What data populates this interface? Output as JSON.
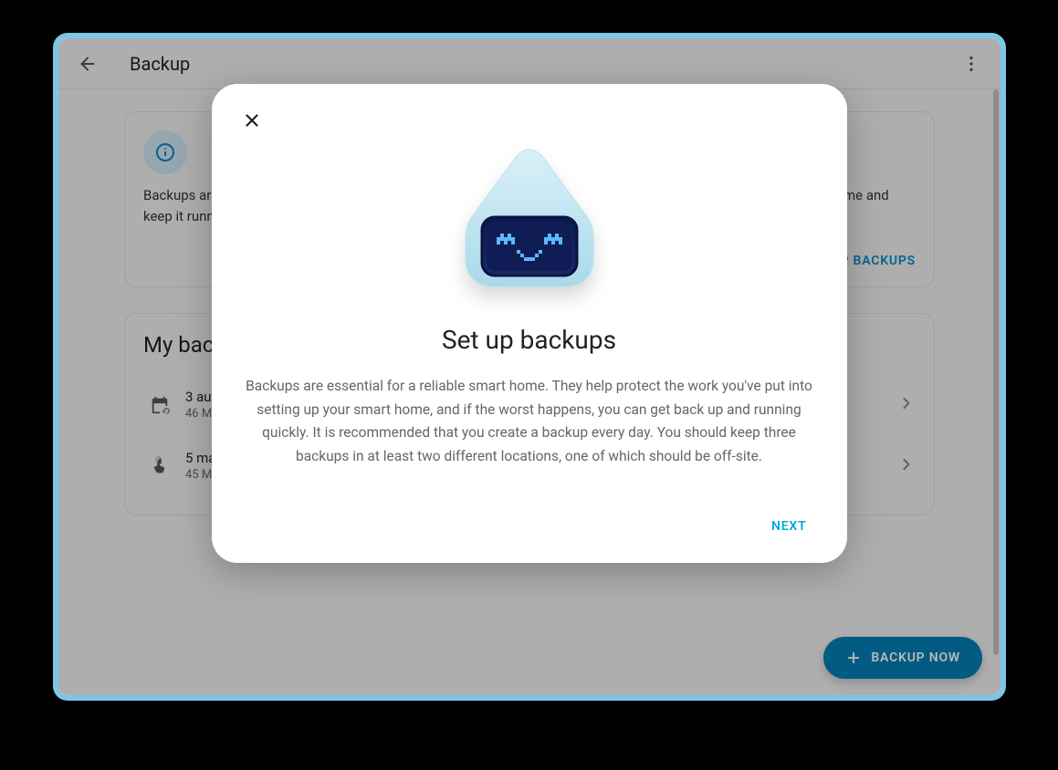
{
  "header": {
    "title": "Backup"
  },
  "info_card": {
    "text": "Backups are essential for a reliable smart home. They help protect the work you've put into setting up your smart home and keep it running.",
    "action_label": "SET UP BACKUPS"
  },
  "my_backups": {
    "title": "My backups",
    "rows": [
      {
        "primary": "3 automatic backups",
        "secondary": "46 MB in total"
      },
      {
        "primary": "5 manual backups",
        "secondary": "45 MB in total"
      }
    ]
  },
  "fab": {
    "label": "BACKUP NOW"
  },
  "dialog": {
    "title": "Set up backups",
    "body": "Backups are essential for a reliable smart home. They help protect the work you've put into setting up your smart home, and if the worst happens, you can get back up and running quickly. It is recommended that you create a backup every day. You should keep three backups in at least two different locations, one of which should be off-site.",
    "next_label": "NEXT"
  }
}
